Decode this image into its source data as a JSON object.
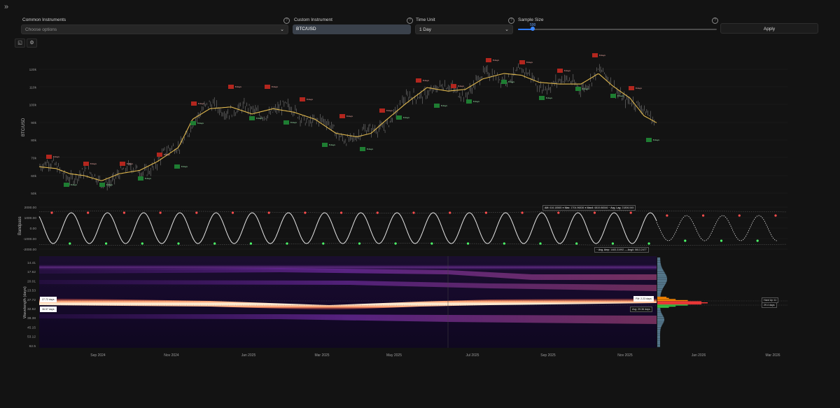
{
  "controls": {
    "common_label": "Common Instruments",
    "common_placeholder": "Choose options",
    "custom_label": "Custom Instrument",
    "custom_value": "BTC/USD",
    "time_unit_label": "Time Unit",
    "time_unit_value": "1 Day",
    "sample_size_label": "Sample Size",
    "sample_size_value": "500",
    "apply_label": "Apply"
  },
  "colors": {
    "background": "#131313",
    "candles": "#8f8f8f",
    "ma_line": "#e0b84e",
    "high_marker": "#b3261e",
    "low_marker": "#1e7d32",
    "heatmap_band": "#fff4c0",
    "heatmap_purple": "#8a2bd0"
  },
  "price_panel": {
    "ylabel": "BTC/USD",
    "ticks": [
      "120k",
      "110k",
      "100k",
      "90k",
      "80k",
      "70k",
      "60k",
      "50k"
    ],
    "high_marker_label": "8 days",
    "low_marker_label": "8 days"
  },
  "bandpass_panel": {
    "ylabel": "Bandpass",
    "ticks": [
      "2000.00",
      "1000.00",
      "0.00",
      "-1000.00",
      "-2000.00"
    ],
    "legend": [
      {
        "key": "AM:",
        "value": "616.18565"
      },
      {
        "key": "Max:",
        "value": "1704.96836"
      },
      {
        "key": "Max4:",
        "value": "6819.86546"
      },
      {
        "key": "Avg. Lag:",
        "value": "21806.545"
      }
    ],
    "legend2": [
      {
        "key": "Avg. Amp:",
        "value": "1483.31992"
      },
      {
        "key": "Avg4:",
        "value": "5813.2477"
      }
    ]
  },
  "heatmap_panel": {
    "ylabel": "Wavelength (days)",
    "ticks": [
      "14.41",
      "17.62",
      "20.01",
      "23.53",
      "27.72",
      "32.62",
      "38.38",
      "45.15",
      "53.12",
      "62.5"
    ],
    "cursor_label_1": "27.72 days",
    "cursor_label_2": "36.57 days",
    "fm_label": "FM: 2.23 days",
    "avg_label": "Avg: 29.36 days",
    "hard_up_label": "Hard Up 11",
    "hard_up_sub": "29.4 days"
  },
  "x_axis": [
    "Sep 2024",
    "Nov 2024",
    "Jan 2025",
    "Mar 2025",
    "May 2025",
    "Jul 2025",
    "Sep 2025",
    "Nov 2025",
    "Jan 2026",
    "Mar 2026"
  ]
}
